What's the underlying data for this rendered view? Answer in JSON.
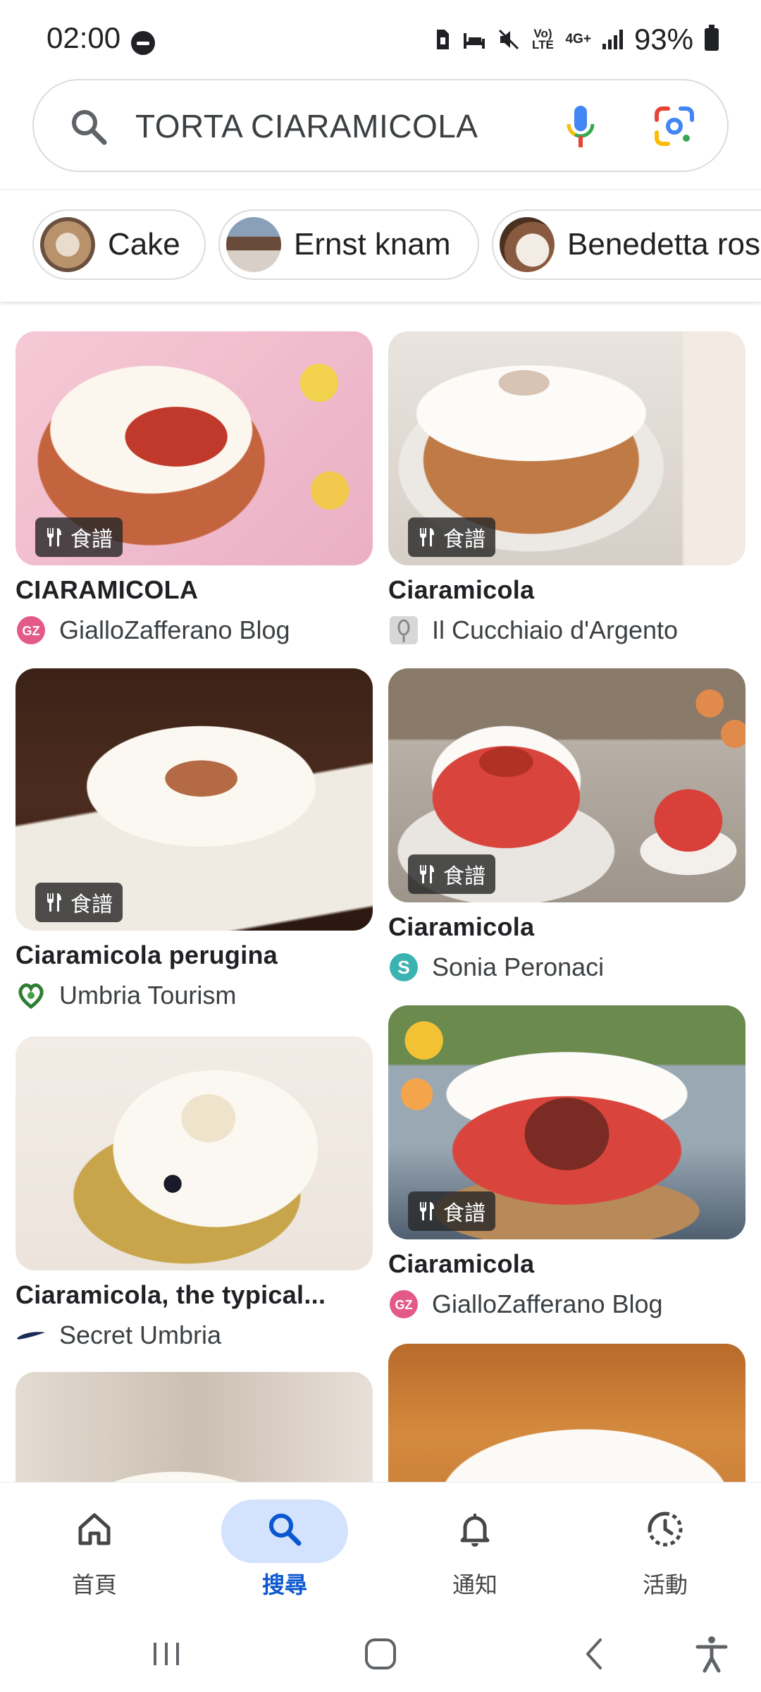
{
  "status_bar": {
    "time": "02:00",
    "volte": "Vo) LTE",
    "network": "4G+",
    "battery": "93%"
  },
  "search": {
    "query": "TORTA CIARAMICOLA"
  },
  "chips": [
    {
      "label": "Cake"
    },
    {
      "label": "Ernst knam"
    },
    {
      "label": "Benedetta rossi"
    }
  ],
  "badge_label": "食譜",
  "results": [
    {
      "title": "CIARAMICOLA",
      "source": "GialloZafferano Blog",
      "badge": true
    },
    {
      "title": "Ciaramicola",
      "source": "Il Cucchiaio d'Argento",
      "badge": true
    },
    {
      "title": "Ciaramicola perugina",
      "source": "Umbria Tourism",
      "badge": true
    },
    {
      "title": "Ciaramicola",
      "source": "Sonia Peronaci",
      "badge": true
    },
    {
      "title": "Ciaramicola, the typical...",
      "source": "Secret Umbria",
      "badge": false
    },
    {
      "title": "Ciaramicola",
      "source": "GialloZafferano Blog",
      "badge": true
    }
  ],
  "bottom_nav": [
    {
      "label": "首頁",
      "icon": "home-icon",
      "active": false
    },
    {
      "label": "搜尋",
      "icon": "search-icon",
      "active": true
    },
    {
      "label": "通知",
      "icon": "bell-icon",
      "active": false
    },
    {
      "label": "活動",
      "icon": "activity-icon",
      "active": false
    }
  ],
  "colors": {
    "accent": "#0b57d0",
    "active_pill": "#d3e3fd",
    "google_blue": "#4285f4",
    "google_red": "#ea4335",
    "google_yellow": "#fbbc04",
    "google_green": "#34a853"
  }
}
